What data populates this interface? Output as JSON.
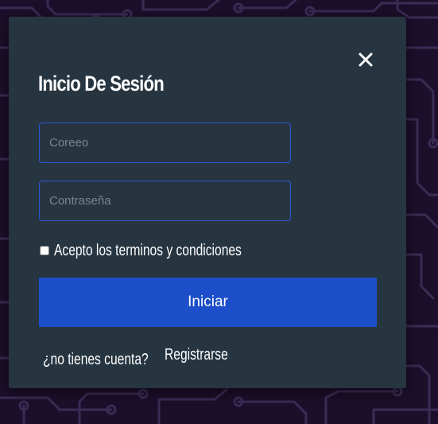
{
  "login_modal": {
    "title": "Inicio De Sesión",
    "close_icon": "close-icon",
    "email_placeholder": "Coreeo",
    "email_value": "",
    "password_placeholder": "Contraseña",
    "password_value": "",
    "terms_checked": false,
    "terms_label": "Acepto los terminos y condiciones",
    "submit_label": "Iniciar",
    "no_account_text": "¿no tienes cuenta?",
    "register_label": "Registrarse"
  },
  "colors": {
    "background": "#1c0f2b",
    "circuit_lines": "#3a2c55",
    "modal_background": "#263540",
    "input_border": "#2f55d4",
    "primary_button": "#1e4fca",
    "text": "#ffffff",
    "placeholder": "#7b8590"
  }
}
